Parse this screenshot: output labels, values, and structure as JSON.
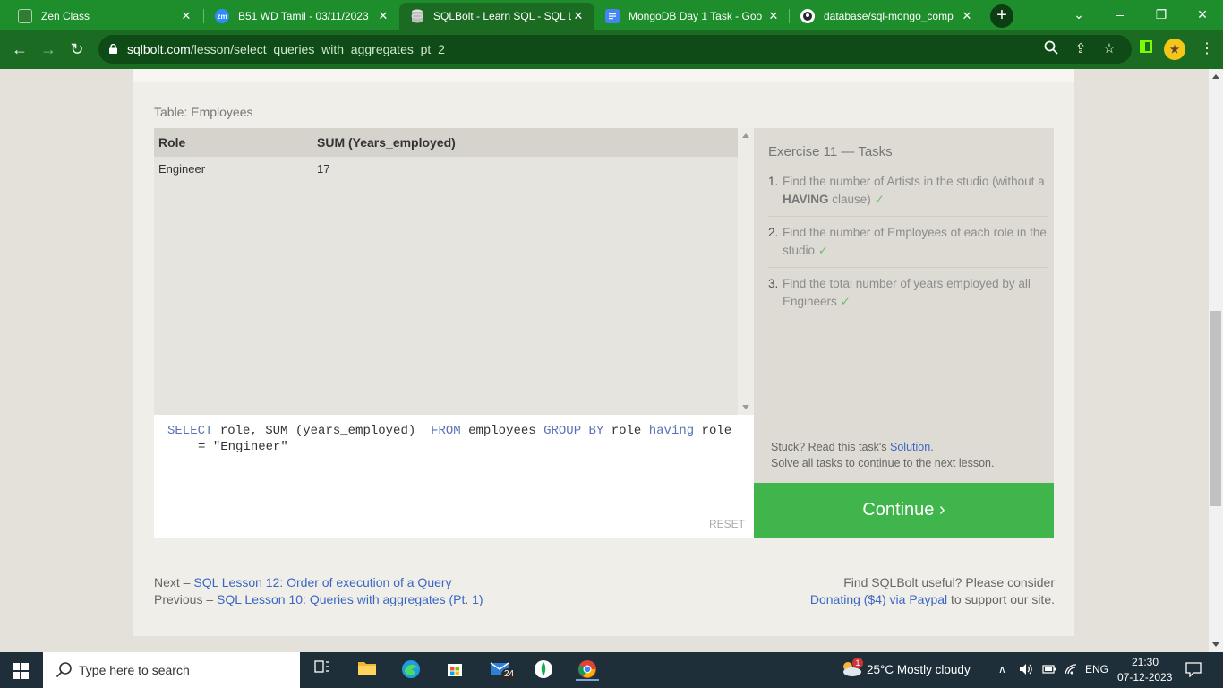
{
  "browser": {
    "tabs": [
      {
        "title": "Zen Class",
        "active": false
      },
      {
        "title": "B51 WD Tamil - 03/11/2023",
        "active": false
      },
      {
        "title": "SQLBolt - Learn SQL - SQL L",
        "active": true
      },
      {
        "title": "MongoDB Day 1 Task - Goo",
        "active": false
      },
      {
        "title": "database/sql-mongo_comp",
        "active": false
      }
    ],
    "url_domain": "sqlbolt.com",
    "url_path": "/lesson/select_queries_with_aggregates_pt_2",
    "accent_color": "#1e8e2c"
  },
  "page": {
    "table_caption": "Table: Employees",
    "results": {
      "columns": [
        "Role",
        "SUM (Years_employed)"
      ],
      "rows": [
        [
          "Engineer",
          "17"
        ]
      ]
    },
    "query": {
      "kw_select": "SELECT",
      "part1": " role, SUM (years_employed)  ",
      "kw_from": "FROM",
      "part2": " employees ",
      "kw_group_by": "GROUP BY",
      "part3": " role ",
      "kw_having": "having",
      "part4": " role",
      "line2_op": "= ",
      "line2_str": "\"Engineer\""
    },
    "reset_label": "RESET",
    "exercise": {
      "title": "Exercise 11 — Tasks",
      "tasks": [
        {
          "num": "1.",
          "text_a": "Find the number of Artists in the studio (without a ",
          "bold": "HAVING",
          "text_b": " clause)",
          "check": "✓"
        },
        {
          "num": "2.",
          "text_a": "Find the number of Employees of each role in the studio",
          "bold": "",
          "text_b": "",
          "check": "✓"
        },
        {
          "num": "3.",
          "text_a": "Find the total number of years employed by all Engineers",
          "bold": "",
          "text_b": "",
          "check": "✓"
        }
      ],
      "stuck_prefix": "Stuck? Read this task's ",
      "stuck_link": "Solution",
      "stuck_suffix": ".",
      "solve_all": "Solve all tasks to continue to the next lesson."
    },
    "continue_label": "Continue ›",
    "footer": {
      "next_prefix": "Next – ",
      "next_link": "SQL Lesson 12: Order of execution of a Query",
      "prev_prefix": "Previous – ",
      "prev_link": "SQL Lesson 10: Queries with aggregates (Pt. 1)",
      "support_line": "Find SQLBolt useful? Please consider",
      "donate_link": "Donating ($4) via Paypal",
      "donate_suffix": " to support our site."
    }
  },
  "taskbar": {
    "search_placeholder": "Type here to search",
    "mail_badge": "24",
    "weather_badge": "1",
    "weather": "25°C  Mostly cloudy",
    "language": "ENG",
    "time": "21:30",
    "date": "07-12-2023"
  }
}
